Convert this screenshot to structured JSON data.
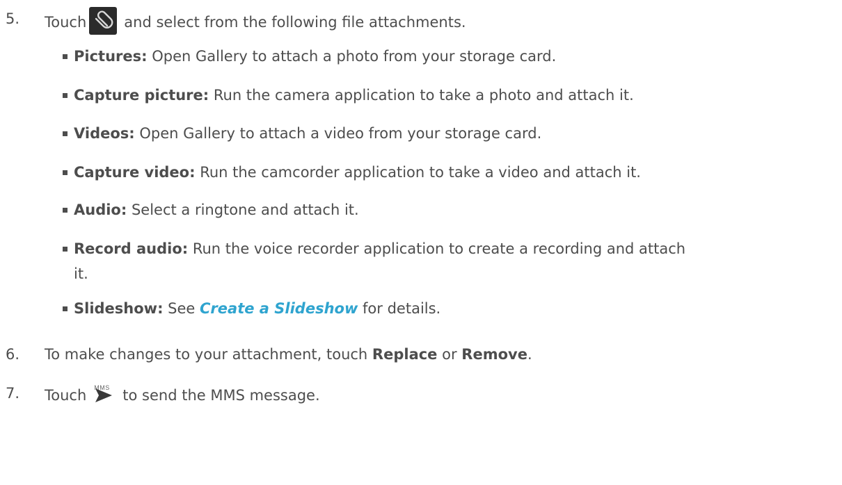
{
  "steps": {
    "s5": {
      "number": "5.",
      "before_icon": "Touch",
      "icon": "paperclip-icon",
      "after_icon": "and select from the following file attachments."
    },
    "s6": {
      "number": "6.",
      "text_a": "To make changes to your attachment, touch ",
      "replace": "Replace",
      "text_b": " or ",
      "remove": "Remove",
      "text_c": "."
    },
    "s7": {
      "number": "7.",
      "before_icon": "Touch",
      "icon": "send-mms-icon",
      "icon_label": "MMS",
      "after_icon": "to send the MMS message."
    }
  },
  "attachments": [
    {
      "term": "Pictures:",
      "desc": " Open Gallery to attach a photo from your storage card."
    },
    {
      "term": "Capture picture:",
      "desc": " Run the camera application to take a photo and attach it."
    },
    {
      "term": "Videos:",
      "desc": " Open Gallery to attach a video from your storage card."
    },
    {
      "term": "Capture video:",
      "desc": " Run the camcorder application to take a video and attach it."
    },
    {
      "term": "Audio:",
      "desc": " Select a ringtone and attach it."
    },
    {
      "term": "Record audio:",
      "desc": " Run the voice recorder application to create a recording and attach",
      "desc_cont": "it."
    },
    {
      "term": "Slideshow:",
      "desc_pre": " See ",
      "link": "Create a Slideshow",
      "desc_post": " for details."
    }
  ],
  "colors": {
    "text": "#4d4d4d",
    "link": "#2fa4cf",
    "icon_bg": "#2b2b2b"
  }
}
